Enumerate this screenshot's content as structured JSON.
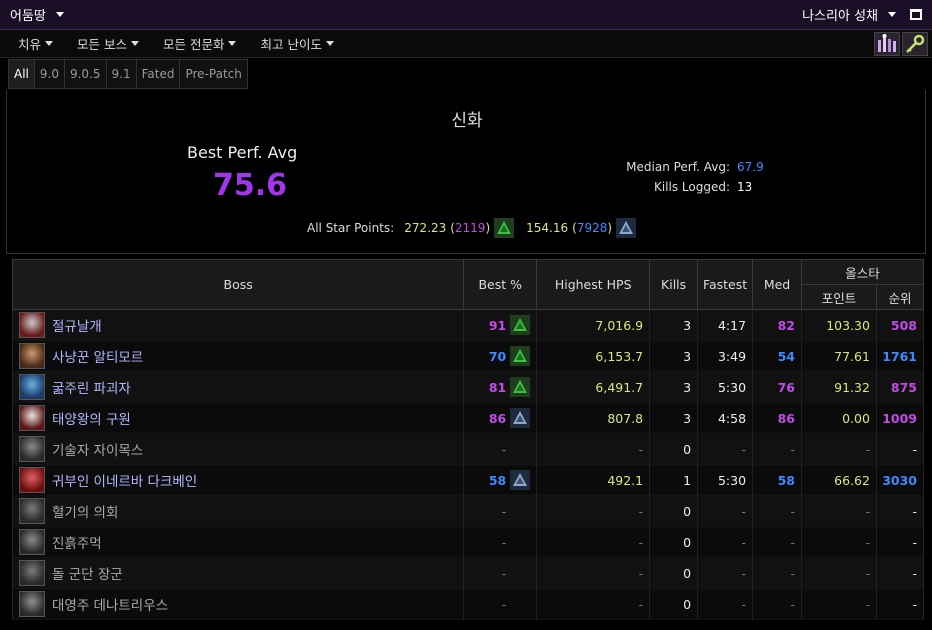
{
  "topbar": {
    "region_label": "어둠땅",
    "raid_label": "나스리아 성채"
  },
  "filters": [
    "치유",
    "모든 보스",
    "모든 전문화",
    "최고 난이도"
  ],
  "patches": [
    "All",
    "9.0",
    "9.0.5",
    "9.1",
    "Fated",
    "Pre-Patch"
  ],
  "summary": {
    "difficulty": "신화",
    "best_perf_label": "Best Perf. Avg",
    "best_perf_value": "75.6",
    "median_label": "Median Perf. Avg:",
    "median_value": "67.9",
    "kills_label": "Kills Logged:",
    "kills_value": "13",
    "star_label": "All Star Points:",
    "star1_points": "272.23",
    "star1_rank": "2119",
    "star2_points": "154.16",
    "star2_rank": "7928",
    "open_paren": "(",
    "close_paren": ")"
  },
  "table": {
    "headers": {
      "boss": "Boss",
      "best": "Best %",
      "hps": "Highest HPS",
      "kills": "Kills",
      "fastest": "Fastest",
      "med": "Med",
      "allstar": "올스타",
      "points": "포인트",
      "rank": "순위"
    },
    "rows": [
      {
        "name": "절규날개",
        "best": "91",
        "best_color": "purple",
        "hps": "7,016.9",
        "kills": "3",
        "fastest": "4:17",
        "med": "82",
        "med_color": "purple",
        "points": "103.30",
        "rank": "508",
        "rank_color": "purple",
        "killed": true,
        "badge": "green"
      },
      {
        "name": "사냥꾼 알티모르",
        "best": "70",
        "best_color": "blue",
        "hps": "6,153.7",
        "kills": "3",
        "fastest": "3:49",
        "med": "54",
        "med_color": "blue",
        "points": "77.61",
        "rank": "1761",
        "rank_color": "blue",
        "killed": true,
        "badge": "green"
      },
      {
        "name": "굶주린 파괴자",
        "best": "81",
        "best_color": "purple",
        "hps": "6,491.7",
        "kills": "3",
        "fastest": "5:30",
        "med": "76",
        "med_color": "purple",
        "points": "91.32",
        "rank": "875",
        "rank_color": "purple",
        "killed": true,
        "badge": "green"
      },
      {
        "name": "태양왕의 구원",
        "best": "86",
        "best_color": "purple",
        "hps": "807.8",
        "kills": "3",
        "fastest": "4:58",
        "med": "86",
        "med_color": "purple",
        "points": "0.00",
        "rank": "1009",
        "rank_color": "purple",
        "killed": true,
        "badge": "blue"
      },
      {
        "name": "기술자 자이목스",
        "best": "-",
        "best_color": "dash",
        "hps": "-",
        "kills": "0",
        "fastest": "-",
        "med": "-",
        "med_color": "dash",
        "points": "-",
        "rank": "-",
        "rank_color": "white",
        "killed": false,
        "badge": "none"
      },
      {
        "name": "귀부인 이네르바 다크베인",
        "best": "58",
        "best_color": "blue",
        "hps": "492.1",
        "kills": "1",
        "fastest": "5:30",
        "med": "58",
        "med_color": "blue",
        "points": "66.62",
        "rank": "3030",
        "rank_color": "blue",
        "killed": true,
        "badge": "blue"
      },
      {
        "name": "혈기의 의회",
        "best": "-",
        "best_color": "dash",
        "hps": "-",
        "kills": "0",
        "fastest": "-",
        "med": "-",
        "med_color": "dash",
        "points": "-",
        "rank": "-",
        "rank_color": "white",
        "killed": false,
        "badge": "none"
      },
      {
        "name": "진흙주먹",
        "best": "-",
        "best_color": "dash",
        "hps": "-",
        "kills": "0",
        "fastest": "-",
        "med": "-",
        "med_color": "dash",
        "points": "-",
        "rank": "-",
        "rank_color": "white",
        "killed": false,
        "badge": "none"
      },
      {
        "name": "돌 군단 장군",
        "best": "-",
        "best_color": "dash",
        "hps": "-",
        "kills": "0",
        "fastest": "-",
        "med": "-",
        "med_color": "dash",
        "points": "-",
        "rank": "-",
        "rank_color": "white",
        "killed": false,
        "badge": "none"
      },
      {
        "name": "대영주 데나트리우스",
        "best": "-",
        "best_color": "dash",
        "hps": "-",
        "kills": "0",
        "fastest": "-",
        "med": "-",
        "med_color": "dash",
        "points": "-",
        "rank": "-",
        "rank_color": "white",
        "killed": false,
        "badge": "none"
      }
    ]
  },
  "colors": {
    "purple": "#c24be8",
    "blue": "#3a8bff",
    "green": "#d8e87a",
    "accent_bg": "#1a0f26"
  }
}
